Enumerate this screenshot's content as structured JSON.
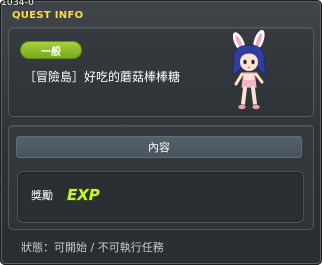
{
  "window": {
    "id_text": "1034-0",
    "title": "QUEST INFO"
  },
  "quest": {
    "category_badge": "一般",
    "name": "［冒險島］好吃的蘑菇棒棒糖"
  },
  "content": {
    "header": "內容",
    "reward_label": "獎勵",
    "reward_icon": "exp-icon",
    "reward_icon_text": "EXP"
  },
  "status": {
    "text": "狀態：可開始 / 不可執行任務"
  },
  "colors": {
    "title": "#ffd94a",
    "badge": "#8fbf2a",
    "exp_text": "#c6f23a"
  }
}
